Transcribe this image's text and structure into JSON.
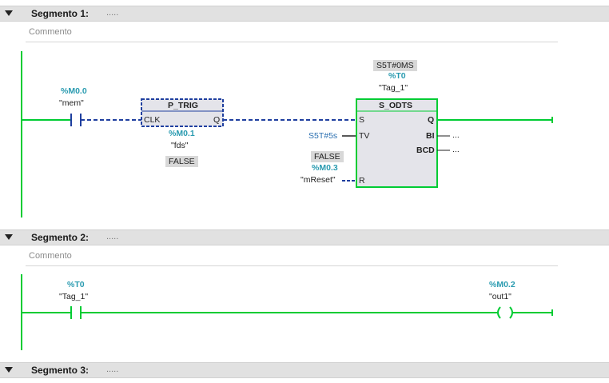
{
  "segments": [
    {
      "title": "Segmento 1:",
      "dots": ".....",
      "comment": "Commento"
    },
    {
      "title": "Segmento 2:",
      "dots": ".....",
      "comment": "Commento"
    },
    {
      "title": "Segmento 3:",
      "dots": "....."
    }
  ],
  "network1": {
    "contact": {
      "address": "%M0.0",
      "tag": "\"mem\""
    },
    "p_trig": {
      "name": "P_TRIG",
      "pin_in": "CLK",
      "pin_out": "Q",
      "address": "%M0.1",
      "tag": "\"fds\"",
      "value": "FALSE"
    },
    "timer": {
      "preset_value": "S5T#0MS",
      "address": "%T0",
      "tag": "\"Tag_1\"",
      "name": "S_ODTS",
      "pin_s": "S",
      "pin_tv": "TV",
      "pin_r": "R",
      "pin_q": "Q",
      "pin_bi": "BI",
      "pin_bcd": "BCD",
      "tv_value": "S5T#5s",
      "reset_value": "FALSE",
      "reset_address": "%M0.3",
      "reset_tag": "\"mReset\"",
      "open_output": "..."
    }
  },
  "network2": {
    "contact": {
      "address": "%T0",
      "tag": "\"Tag_1\""
    },
    "coil": {
      "address": "%M0.2",
      "tag": "\"out1\""
    }
  },
  "colors": {
    "rail": "#00cc33",
    "dashed": "#1f3f9f",
    "block_border": "#1f3f9f",
    "timer_border": "#00cc33",
    "header_bg": "#e1e1e1",
    "address": "#2a9bb0"
  }
}
